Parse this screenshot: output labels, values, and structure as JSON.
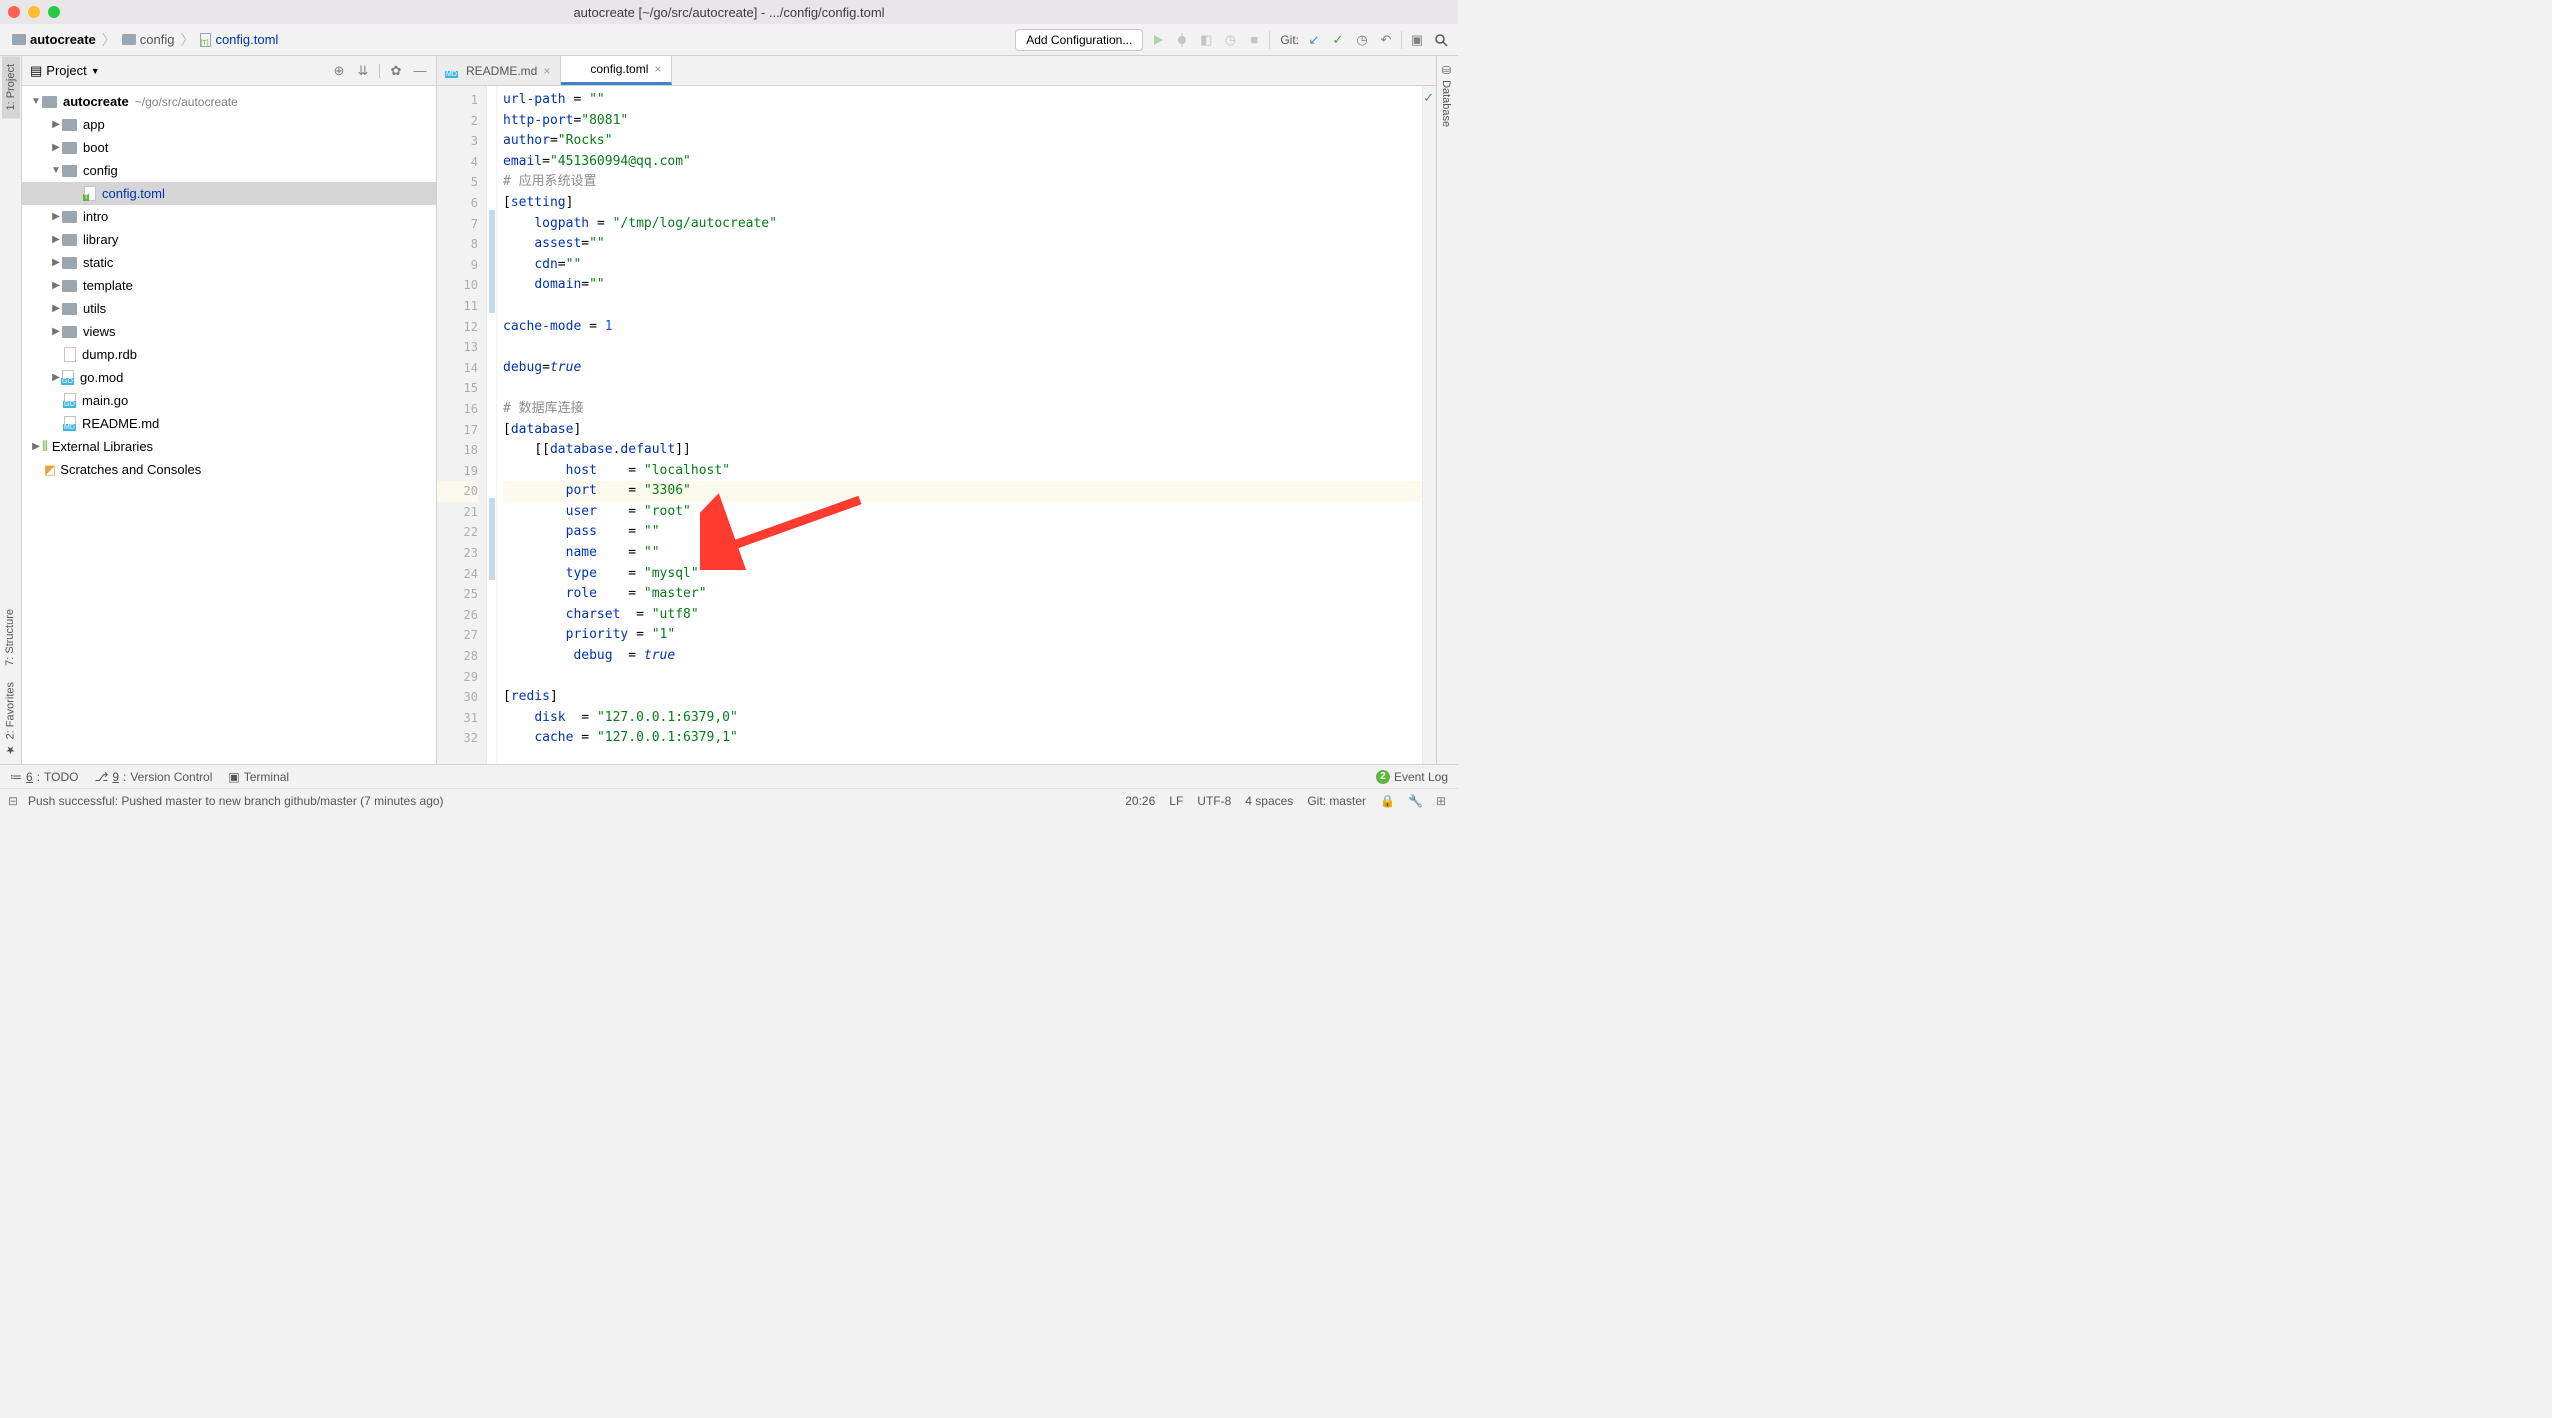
{
  "window": {
    "title": "autocreate [~/go/src/autocreate] - .../config/config.toml"
  },
  "breadcrumbs": {
    "root": "autocreate",
    "folder": "config",
    "file": "config.toml"
  },
  "navbar": {
    "add_configuration": "Add Configuration...",
    "git_label": "Git:"
  },
  "project_panel": {
    "title": "Project",
    "root": {
      "name": "autocreate",
      "path": "~/go/src/autocreate"
    },
    "folders": {
      "app": "app",
      "boot": "boot",
      "config": "config",
      "config_file": "config.toml",
      "intro": "intro",
      "library": "library",
      "static": "static",
      "template": "template",
      "utils": "utils",
      "views": "views"
    },
    "files": {
      "dump": "dump.rdb",
      "gomod": "go.mod",
      "maingo": "main.go",
      "readme": "README.md"
    },
    "ext_libs": "External Libraries",
    "scratches": "Scratches and Consoles"
  },
  "left_rails": {
    "project": "1: Project",
    "structure": "7: Structure",
    "favorites": "2: Favorites"
  },
  "right_rail": {
    "database": "Database"
  },
  "editor": {
    "tabs": {
      "readme": "README.md",
      "config": "config.toml"
    },
    "code_lines": [
      {
        "n": 1
      },
      {
        "n": 2
      },
      {
        "n": 3
      },
      {
        "n": 4
      },
      {
        "n": 5
      },
      {
        "n": 6
      },
      {
        "n": 7
      },
      {
        "n": 8
      },
      {
        "n": 9
      },
      {
        "n": 10
      },
      {
        "n": 11
      },
      {
        "n": 12
      },
      {
        "n": 13
      },
      {
        "n": 14
      },
      {
        "n": 15
      },
      {
        "n": 16
      },
      {
        "n": 17
      },
      {
        "n": 18
      },
      {
        "n": 19
      },
      {
        "n": 20
      },
      {
        "n": 21
      },
      {
        "n": 22
      },
      {
        "n": 23
      },
      {
        "n": 24
      },
      {
        "n": 25
      },
      {
        "n": 26
      },
      {
        "n": 27
      },
      {
        "n": 28
      },
      {
        "n": 29
      },
      {
        "n": 30
      },
      {
        "n": 31
      },
      {
        "n": 32
      }
    ],
    "toml": {
      "url_path_key": "url-path",
      "url_path_val": "\"\"",
      "http_port_key": "http-port",
      "http_port_val": "\"8081\"",
      "author_key": "author",
      "author_val": "\"Rocks\"",
      "email_key": "email",
      "email_val": "\"451360994@qq.com\"",
      "comment1": "# 应用系统设置",
      "setting": "setting",
      "logpath_key": "logpath",
      "logpath_val": "\"/tmp/log/autocreate\"",
      "assest_key": "assest",
      "assest_val": "\"\"",
      "cdn_key": "cdn",
      "cdn_val": "\"\"",
      "domain_key": "domain",
      "domain_val": "\"\"",
      "cache_mode_key": "cache-mode",
      "cache_mode_val": "1",
      "debug_key": "debug",
      "debug_val": "true",
      "comment2": "# 数据库连接",
      "database": "database",
      "database_default": "database",
      "database_default2": "default",
      "host_key": "host",
      "host_val": "\"localhost\"",
      "port_key": "port",
      "port_val": "\"3306\"",
      "user_key": "user",
      "user_val": "\"root\"",
      "pass_key": "pass",
      "pass_val": "\"\"",
      "name_key": "name",
      "name_val": "\"\"",
      "type_key": "type",
      "type_val": "\"mysql\"",
      "role_key": "role",
      "role_val": "\"master\"",
      "charset_key": "charset",
      "charset_val": "\"utf8\"",
      "priority_key": "priority",
      "priority_val": "\"1\"",
      "debug2_key": "debug",
      "debug2_val": "true",
      "redis": "redis",
      "disk_key": "disk",
      "disk_val": "\"127.0.0.1:6379,0\"",
      "cache_key": "cache",
      "cache_val": "\"127.0.0.1:6379,1\""
    }
  },
  "bottom_toolbar": {
    "todo": "TODO",
    "todo_hotkey": "6",
    "vc": "Version Control",
    "vc_hotkey": "9",
    "terminal": "Terminal",
    "event_log": "Event Log",
    "event_count": "2"
  },
  "status_bar": {
    "message": "Push successful: Pushed master to new branch github/master (7 minutes ago)",
    "cursor": "20:26",
    "line_sep": "LF",
    "encoding": "UTF-8",
    "indent": "4 spaces",
    "git_branch": "Git: master"
  }
}
